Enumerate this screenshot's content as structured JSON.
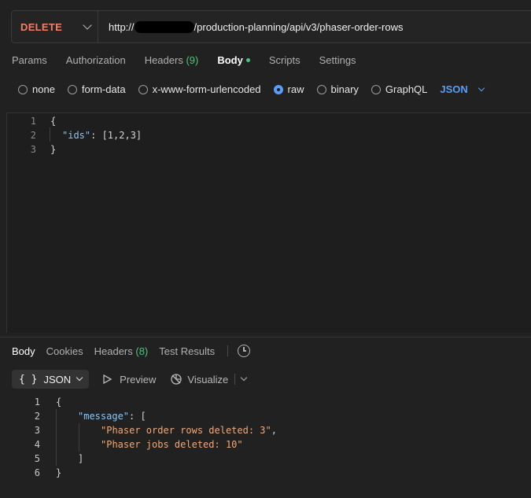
{
  "request": {
    "method": "DELETE",
    "url_prefix": "http://",
    "url_path": "/production-planning/api/v3/phaser-order-rows"
  },
  "request_tabs": [
    {
      "label": "Params"
    },
    {
      "label": "Authorization"
    },
    {
      "label": "Headers",
      "count": "(9)"
    },
    {
      "label": "Body"
    },
    {
      "label": "Scripts"
    },
    {
      "label": "Settings"
    }
  ],
  "body_types": [
    "none",
    "form-data",
    "x-www-form-urlencoded",
    "raw",
    "binary",
    "GraphQL"
  ],
  "body_selected": "raw",
  "body_language": "JSON",
  "request_body": {
    "lines": [
      {
        "n": "1",
        "open": "{"
      },
      {
        "n": "2",
        "key": "\"ids\"",
        "sep": ": ",
        "value": "[1,2,3]"
      },
      {
        "n": "3",
        "close": "}"
      }
    ]
  },
  "response_tabs": [
    {
      "label": "Body"
    },
    {
      "label": "Cookies"
    },
    {
      "label": "Headers",
      "count": "(8)"
    },
    {
      "label": "Test Results"
    }
  ],
  "response_toolbar": {
    "format_braces": "{ }",
    "format_label": "JSON",
    "preview_label": "Preview",
    "visualize_label": "Visualize"
  },
  "response_body": {
    "lines": [
      {
        "n": "1",
        "text": "{"
      },
      {
        "n": "2",
        "key": "\"message\"",
        "sep": ": ["
      },
      {
        "n": "3",
        "str": "\"Phaser order rows deleted: 3\"",
        "tail": ","
      },
      {
        "n": "4",
        "str": "\"Phaser jobs deleted: 10\""
      },
      {
        "n": "5",
        "text": "]"
      },
      {
        "n": "6",
        "text": "}"
      }
    ]
  },
  "colors": {
    "background": "#212121",
    "method": "#f27e6a",
    "accent_blue": "#5a9cf8",
    "count_green": "#4fc37a",
    "json_key": "#8fc4f2",
    "json_string": "#f0a879"
  }
}
